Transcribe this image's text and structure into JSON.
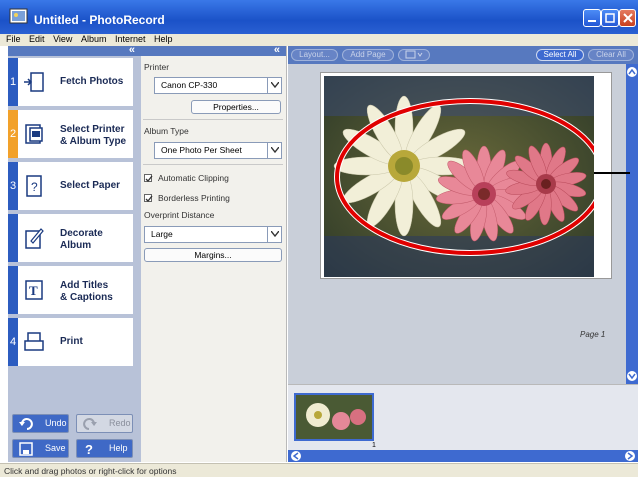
{
  "window": {
    "title": "Untitled - PhotoRecord"
  },
  "menu": [
    "File",
    "Edit",
    "View",
    "Album",
    "Internet",
    "Help"
  ],
  "left_panel": {
    "collapse": "«",
    "steps": [
      {
        "num": "1",
        "label_1": "Fetch Photos",
        "label_2": "",
        "icon": "fetch-photos-icon"
      },
      {
        "num": "2",
        "label_1": "Select Printer",
        "label_2": "& Album Type",
        "icon": "select-printer-icon",
        "active": true
      },
      {
        "num": "3",
        "label_1": "Select Paper",
        "label_2": "",
        "icon": "select-paper-icon"
      },
      {
        "num": "",
        "label_1": "Decorate",
        "label_2": "Album",
        "icon": "decorate-album-icon"
      },
      {
        "num": "",
        "label_1": "Add Titles",
        "label_2": "& Captions",
        "icon": "add-titles-icon"
      },
      {
        "num": "4",
        "label_1": "Print",
        "label_2": "",
        "icon": "print-icon"
      }
    ],
    "undo": "Undo",
    "redo": "Redo",
    "save": "Save",
    "help": "Help"
  },
  "settings": {
    "collapse": "«",
    "printer_label": "Printer",
    "printer_value": "Canon CP-330",
    "properties": "Properties...",
    "album_type_label": "Album Type",
    "album_type_value": "One Photo Per Sheet",
    "auto_clipping": "Automatic Clipping",
    "borderless": "Borderless Printing",
    "overprint_label": "Overprint Distance",
    "overprint_value": "Large",
    "margins": "Margins..."
  },
  "toolbar": {
    "layout": "Layout...",
    "add_page": "Add Page",
    "select_all": "Select All",
    "clear_all": "Clear All"
  },
  "canvas": {
    "page_label": "Page 1"
  },
  "thumbnails": {
    "items": [
      {
        "num": "1"
      }
    ]
  },
  "status": "Click and drag photos or right-click for options",
  "colors": {
    "titlebar": "#1b52c8",
    "panel_header": "#5779bf",
    "active_step": "#f2a12a",
    "highlight_ellipse": "#e00000"
  }
}
